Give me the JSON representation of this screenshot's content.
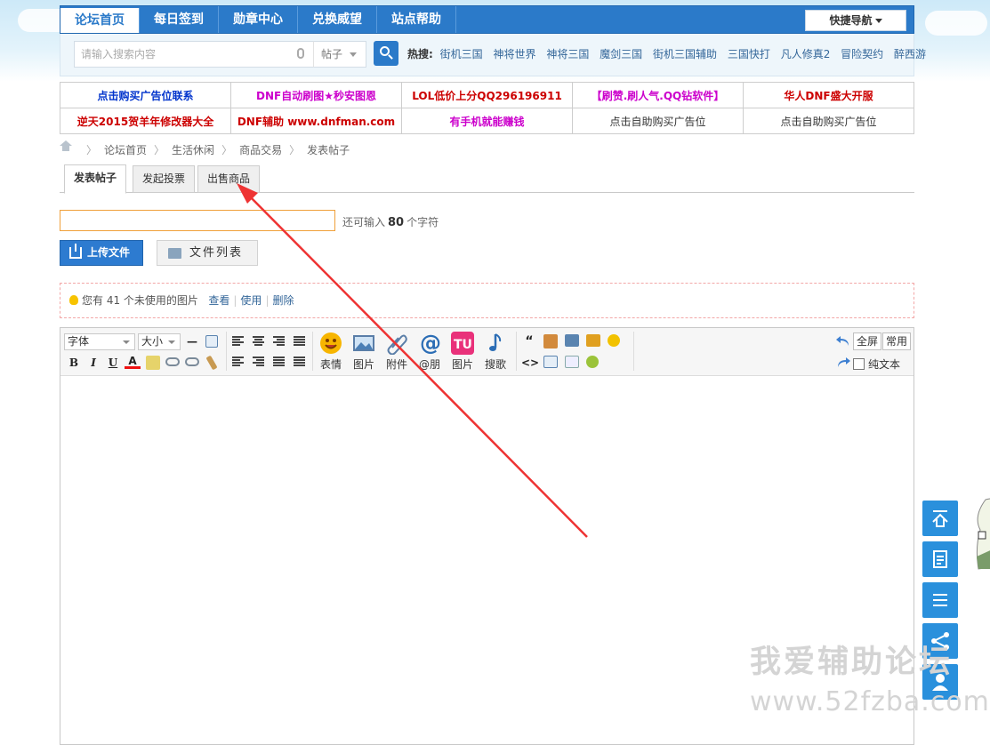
{
  "nav": {
    "items": [
      "论坛首页",
      "每日签到",
      "勋章中心",
      "兑换威望",
      "站点帮助"
    ],
    "quick_nav": "快捷导航"
  },
  "search": {
    "placeholder": "请输入搜索内容",
    "type": "帖子",
    "hot_label": "热搜:",
    "hot_terms": [
      "街机三国",
      "神将世界",
      "神将三国",
      "魔剑三国",
      "街机三国辅助",
      "三国快打",
      "凡人修真2",
      "冒险契约",
      "醉西游"
    ]
  },
  "ads": {
    "row1": [
      "点击购买广告位联系",
      "DNF自动刷图★秒安图恩",
      "LOL低价上分QQ296196911",
      "【刷赞.刷人气.QQ钻软件】",
      "华人DNF盛大开服"
    ],
    "row2": [
      "逆天2015贺羊年修改器大全",
      "DNF辅助 www.dnfman.com",
      "有手机就能赚钱",
      "点击自助购买广告位",
      "点击自助购买广告位"
    ],
    "colors": {
      "blue": "#0033cc",
      "magenta": "#cc00cc",
      "red": "#cc0000",
      "gray": "#333333"
    }
  },
  "breadcrumb": [
    "论坛首页",
    "生活休闲",
    "商品交易",
    "发表帖子"
  ],
  "tabs": [
    "发表帖子",
    "发起投票",
    "出售商品"
  ],
  "subject": {
    "value": "",
    "counter_prefix": "还可输入",
    "counter_value": "80",
    "counter_suffix": "个字符"
  },
  "upload": {
    "upload_label": "上传文件",
    "list_label": "文件列表"
  },
  "notice": {
    "text": "您有 41 个未使用的图片",
    "view": "查看",
    "use": "使用",
    "delete": "删除"
  },
  "editor": {
    "font_label": "字体",
    "size_label": "大小",
    "big_buttons": [
      "表情",
      "图片",
      "附件",
      "@朋",
      "图片",
      "搜歌"
    ],
    "fullscreen": "全屏",
    "common": "常用",
    "plain_text": "纯文本"
  },
  "watermark": {
    "line1": "我爱辅助论坛",
    "line2": "www.52fzba.com"
  },
  "colors": {
    "accent": "#2b7ac9",
    "float": "#2a90dc",
    "arrow": "#ee3333"
  }
}
